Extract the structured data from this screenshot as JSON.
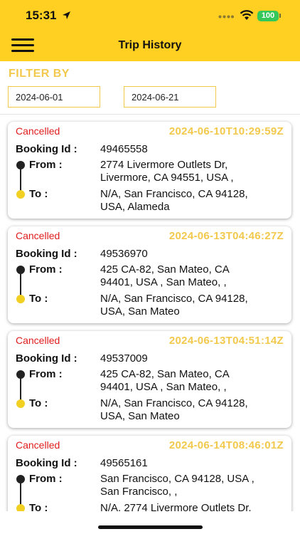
{
  "status_bar": {
    "time": "15:31",
    "battery": "100"
  },
  "header": {
    "title": "Trip History"
  },
  "filter": {
    "label": "FILTER BY",
    "from_value": "2024-06-01",
    "to_value": "2024-06-21"
  },
  "labels": {
    "booking": "Booking Id :",
    "from": "From   :",
    "to": "To :"
  },
  "trips": [
    {
      "status": "Cancelled",
      "datetime": "2024-06-10T10:29:59Z",
      "booking_id": "49465558",
      "from_line1": "2774 Livermore Outlets Dr,",
      "from_line2": "Livermore, CA 94551, USA ,",
      "to_line1": "N/A, San Francisco, CA 94128,",
      "to_line2": "USA, Alameda"
    },
    {
      "status": "Cancelled",
      "datetime": "2024-06-13T04:46:27Z",
      "booking_id": "49536970",
      "from_line1": "425 CA-82, San Mateo, CA",
      "from_line2": "94401, USA , San Mateo, ,",
      "to_line1": "N/A, San Francisco, CA 94128,",
      "to_line2": "USA, San Mateo"
    },
    {
      "status": "Cancelled",
      "datetime": "2024-06-13T04:51:14Z",
      "booking_id": "49537009",
      "from_line1": "425 CA-82, San Mateo, CA",
      "from_line2": "94401, USA , San Mateo, ,",
      "to_line1": "N/A, San Francisco, CA 94128,",
      "to_line2": "USA, San Mateo"
    },
    {
      "status": "Cancelled",
      "datetime": "2024-06-14T08:46:01Z",
      "booking_id": "49565161",
      "from_line1": "San Francisco, CA 94128, USA ,",
      "from_line2": "San Francisco, ,",
      "to_line1": "N/A, 2774 Livermore Outlets Dr,",
      "to_line2": ""
    }
  ],
  "colors": {
    "brand_yellow": "#FFD021",
    "accent_yellow": "#F2C94C",
    "cancelled_red": "#E01C1C"
  },
  "icons": [
    "menu-icon",
    "location-arrow-icon",
    "wifi-icon",
    "battery-icon",
    "route-start-dot-icon",
    "route-end-dot-icon"
  ]
}
